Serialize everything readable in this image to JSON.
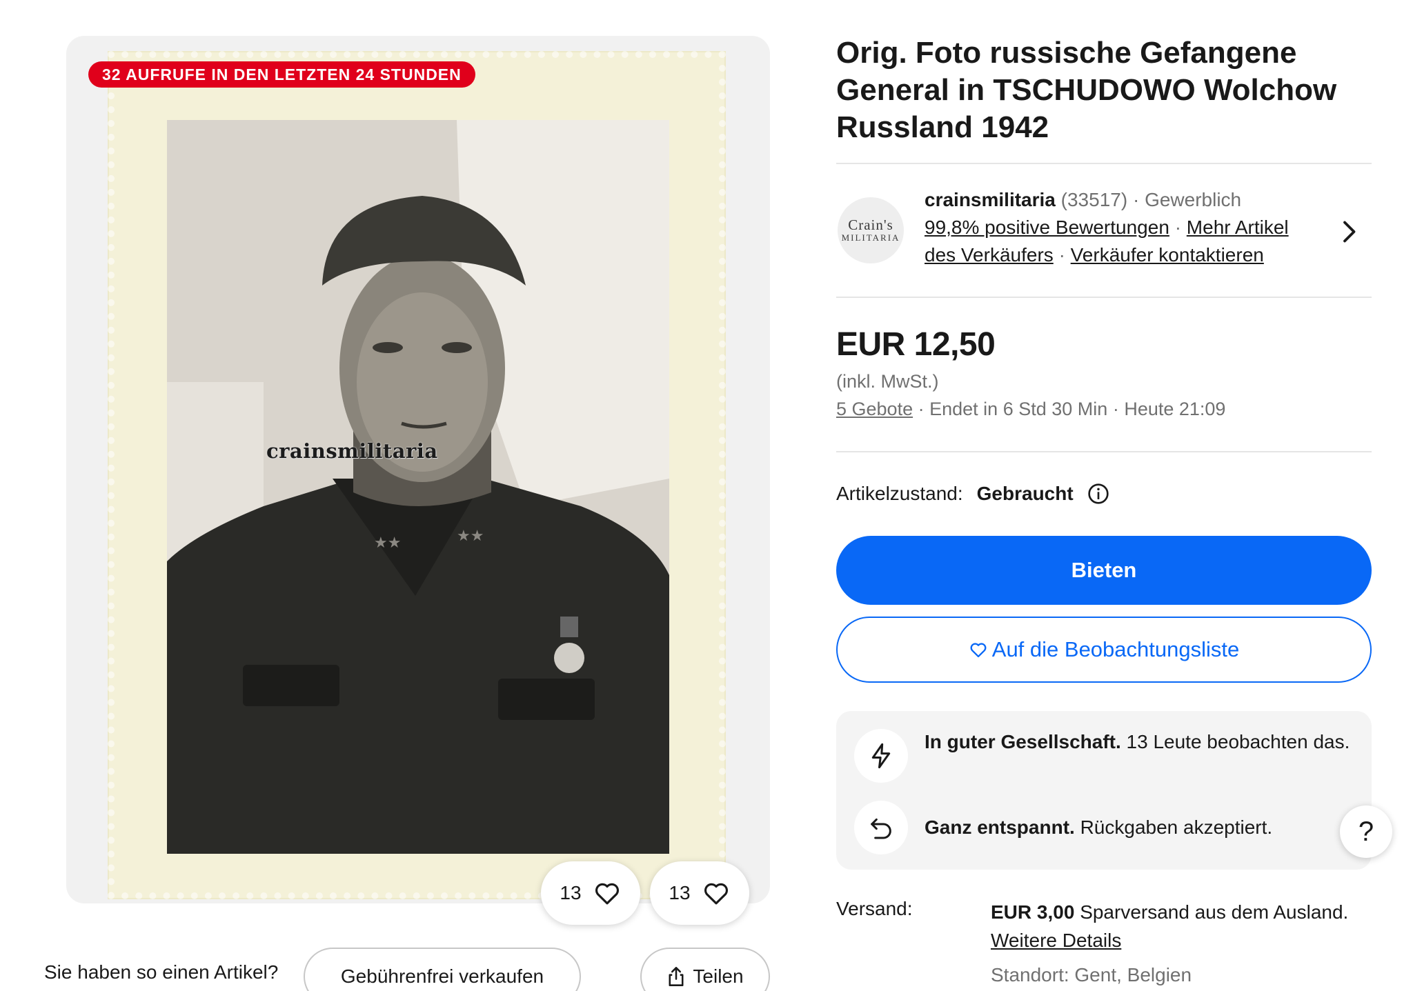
{
  "gallery": {
    "views_badge": "32 AUFRUFE IN DEN LETZTEN 24 STUNDEN",
    "watermark": "crainsmilitaria",
    "watch_count_1": "13",
    "watch_count_2": "13"
  },
  "sell_bar": {
    "prompt": "Sie haben so einen Artikel?",
    "sell_button": "Gebührenfrei verkaufen",
    "share_button": "Teilen"
  },
  "listing": {
    "title": "Orig. Foto russische Gefangene General in TSCHUDOWO Wolchow Russland 1942"
  },
  "seller": {
    "logo_line1": "Crain's",
    "logo_line2": "MILITARIA",
    "name": "crainsmilitaria",
    "feedback_count": "(33517)",
    "sep": "·",
    "type": "Gewerblich",
    "positive": "99,8% positive Bewertungen",
    "more_items": "Mehr Artikel des Verkäufers",
    "contact": "Verkäufer kontaktieren"
  },
  "price": {
    "amount": "EUR 12,50",
    "vat": "(inkl. MwSt.)",
    "bids": "5 Gebote",
    "sep": "·",
    "ends": "Endet in 6 Std 30 Min",
    "end_time": "Heute 21:09"
  },
  "condition": {
    "label": "Artikelzustand:",
    "value": "Gebraucht"
  },
  "actions": {
    "bid": "Bieten",
    "watchlist": "Auf die Beobachtungsliste"
  },
  "signals": {
    "watchers_bold": "In guter Gesellschaft.",
    "watchers_text": "13 Leute beobachten das.",
    "returns_bold": "Ganz entspannt.",
    "returns_text": "Rückgaben akzeptiert."
  },
  "help": {
    "label": "?"
  },
  "shipping": {
    "label": "Versand:",
    "cost": "EUR 3,00",
    "method": "Sparversand aus dem Ausland.",
    "details_link": "Weitere Details",
    "location": "Standort: Gent, Belgien"
  },
  "colors": {
    "primary_blue": "#0968f6",
    "badge_red": "#e0001b",
    "text": "#191919",
    "muted": "#707070"
  },
  "icons": [
    "heart-icon",
    "share-icon",
    "chevron-right-icon",
    "info-icon",
    "lightning-icon",
    "return-arrow-icon"
  ]
}
